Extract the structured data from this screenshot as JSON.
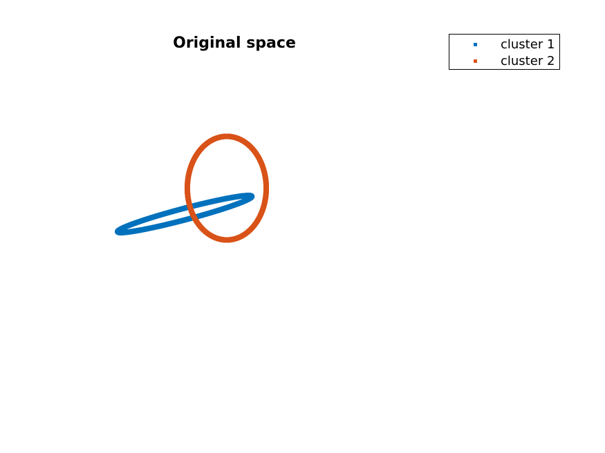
{
  "chart_data": {
    "type": "scatter",
    "title": "Original space",
    "xlabel": "",
    "ylabel": "",
    "axes_visible": false,
    "grid": false,
    "legend_placement": "top-right",
    "xlim": [
      -2.4,
      3.2
    ],
    "ylim": [
      -2.3,
      2.1
    ],
    "series": [
      {
        "name": "cluster 1",
        "color": "#0072BD",
        "shape": "ellipse",
        "center": [
          -0.4,
          -0.3
        ],
        "semi_axis_major": 1.32,
        "semi_axis_minor": 0.11,
        "rotation_deg": 15,
        "num_points": 720
      },
      {
        "name": "cluster 2",
        "color": "#D95319",
        "shape": "ellipse",
        "center": [
          0.4,
          0.2
        ],
        "semi_axis_major": 1.0,
        "semi_axis_minor": 0.75,
        "rotation_deg": 90,
        "num_points": 720
      }
    ]
  }
}
